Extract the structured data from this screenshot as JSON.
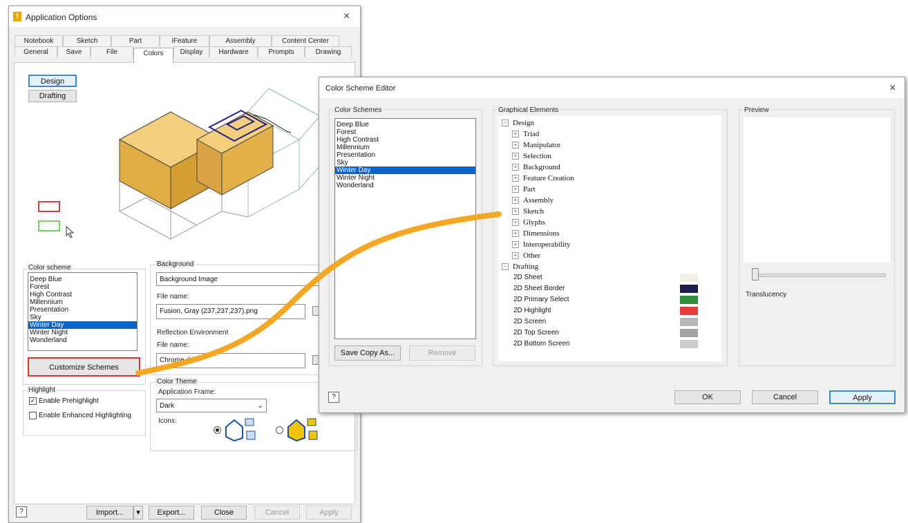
{
  "app_options": {
    "title": "Application Options",
    "close": "×",
    "tabs_row1": [
      "Notebook",
      "Sketch",
      "Part",
      "iFeature",
      "Assembly",
      "Content Center"
    ],
    "tabs_row2": [
      "General",
      "Save",
      "File",
      "Colors",
      "Display",
      "Hardware",
      "Prompts",
      "Drawing"
    ],
    "active_tab": "Colors",
    "mode_buttons": [
      "Design",
      "Drafting"
    ],
    "color_scheme_label": "Color scheme",
    "color_schemes": [
      "Deep Blue",
      "Forest",
      "High Contrast",
      "Millennium",
      "Presentation",
      "Sky",
      "Winter Day",
      "Winter Night",
      "Wonderland"
    ],
    "selected_scheme": "Winter Day",
    "customize_button": "Customize Schemes",
    "highlight_label": "Highlight",
    "enable_prehighlight": "Enable Prehighlight",
    "enable_prehighlight_checked": true,
    "enable_enhanced": "Enable Enhanced Highlighting",
    "enable_enhanced_checked": false,
    "background_label": "Background",
    "background_value": "Background Image",
    "file_name_label": "File name:",
    "bg_file_value": "Fusion, Gray (237,237,237).png",
    "reflection_label": "Reflection Environment",
    "refl_file_label": "File name:",
    "refl_file_value": "Chrome.dds",
    "color_theme_label": "Color Theme",
    "app_frame_label": "Application Frame:",
    "app_frame_value": "Dark",
    "icons_label": "Icons:",
    "footer": {
      "help": "?",
      "import": "Import...",
      "export": "Export...",
      "close": "Close",
      "cancel": "Cancel",
      "apply": "Apply"
    }
  },
  "scheme_editor": {
    "title": "Color Scheme Editor",
    "close": "×",
    "color_schemes_label": "Color Schemes",
    "color_schemes": [
      "Deep Blue",
      "Forest",
      "High Contrast",
      "Millennium",
      "Presentation",
      "Sky",
      "Winter Day",
      "Winter Night",
      "Wonderland"
    ],
    "selected_scheme": "Winter Day",
    "save_copy": "Save Copy As...",
    "remove": "Remove",
    "graphical_label": "Graphical Elements",
    "design_root": "Design",
    "design_children": [
      "Triad",
      "Manipulator",
      "Selection",
      "Background",
      "Feature Creation",
      "Part",
      "Assembly",
      "Sketch",
      "Glyphs",
      "Dimensions",
      "Interoperability",
      "Other"
    ],
    "drafting_root": "Drafting",
    "drafting_items": [
      {
        "label": "2D Sheet",
        "color": "#efefe3"
      },
      {
        "label": "2D Sheet Border",
        "color": "#1c1f4a"
      },
      {
        "label": "2D Primary Select",
        "color": "#2f8f3a"
      },
      {
        "label": "2D Highlight",
        "color": "#e83a3a"
      },
      {
        "label": "2D Screen",
        "color": "#b8b8b8"
      },
      {
        "label": "2D Top Screen",
        "color": "#a2a2a2"
      },
      {
        "label": "2D Bottom Screen",
        "color": "#cccccc"
      }
    ],
    "preview_label": "Preview",
    "translucency_label": "Translucency",
    "help": "?",
    "ok": "OK",
    "cancel": "Cancel",
    "apply": "Apply"
  },
  "colors": {
    "selection_blue": "#0a64c8",
    "callout_red": "#d9312b",
    "connector_orange": "#f5a623",
    "cube_gold": "#e3b657"
  }
}
